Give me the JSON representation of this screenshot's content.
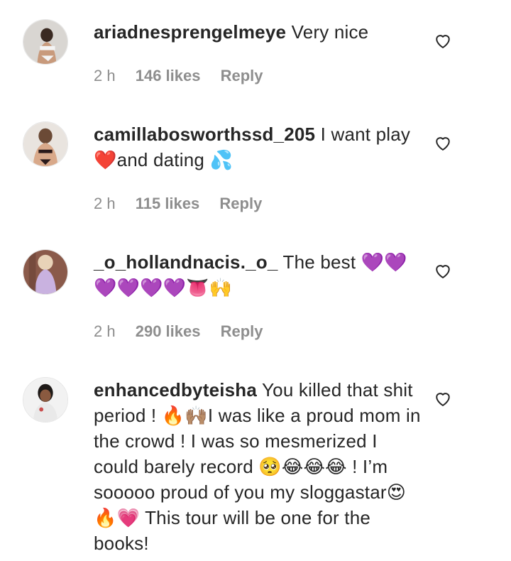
{
  "comments": [
    {
      "username": "ariadnesprengelmeye",
      "text": "Very nice",
      "time": "2 h",
      "likes": "146 likes",
      "reply": "Reply",
      "avatar_icon": "avatar-photo"
    },
    {
      "username": "camillabosworthssd_205",
      "text": "I want play❤️and dating 💦",
      "time": "2 h",
      "likes": "115 likes",
      "reply": "Reply",
      "avatar_icon": "avatar-photo"
    },
    {
      "username": "_o_hollandnacis._o_",
      "text": "The best 💜💜💜💜💜💜👅🙌",
      "time": "2 h",
      "likes": "290 likes",
      "reply": "Reply",
      "avatar_icon": "avatar-photo"
    },
    {
      "username": "enhancedbyteisha",
      "text": "You killed that shit period ! 🔥🙌🏽I was like a proud mom in the crowd ! I was so mesmerized I could barely record 🥺😂😂😂 ! I’m sooooo proud of you my sloggastar😍🔥💗 This tour will be one for the books!",
      "avatar_icon": "avatar-photo"
    }
  ],
  "colors": {
    "text": "#262626",
    "meta": "#8e8e8e"
  },
  "icons": {
    "like": "heart-outline-icon"
  }
}
